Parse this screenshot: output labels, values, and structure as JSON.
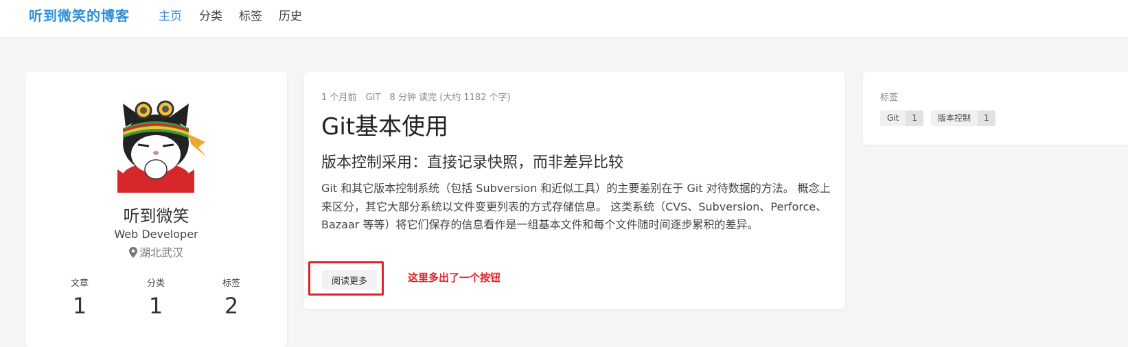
{
  "nav": {
    "brand": "听到微笑的博客",
    "items": [
      {
        "label": "主页",
        "active": true
      },
      {
        "label": "分类",
        "active": false
      },
      {
        "label": "标签",
        "active": false
      },
      {
        "label": "历史",
        "active": false
      }
    ]
  },
  "profile": {
    "name": "听到微笑",
    "role": "Web Developer",
    "location": "湖北武汉",
    "location_icon": "map-pin-icon",
    "stats": [
      {
        "label": "文章",
        "value": "1"
      },
      {
        "label": "分类",
        "value": "1"
      },
      {
        "label": "标签",
        "value": "2"
      }
    ]
  },
  "article": {
    "meta": {
      "time": "1 个月前",
      "category": "GIT",
      "reading": "8 分钟 读完 (大约 1182 个字)"
    },
    "title": "Git基本使用",
    "subtitle": "版本控制采用：直接记录快照，而非差异比较",
    "excerpt": " Git 和其它版本控制系统（包括 Subversion 和近似工具）的主要差别在于 Git 对待数据的方法。 概念上来区分，其它大部分系统以文件变更列表的方式存储信息。 这类系统（CVS、Subversion、Perforce、Bazaar 等等）将它们保存的信息看作是一组基本文件和每个文件随时间逐步累积的差异。",
    "read_more": "阅读更多",
    "annotation": "这里多出了一个按钮",
    "annotation_color": "#e0202a"
  },
  "tags_widget": {
    "title": "标签",
    "tags": [
      {
        "name": "Git",
        "count": "1"
      },
      {
        "name": "版本控制",
        "count": "1"
      }
    ]
  },
  "colors": {
    "brand": "#2f8fd8",
    "nav_active": "#3c86d6",
    "background": "#f5f5f6"
  }
}
